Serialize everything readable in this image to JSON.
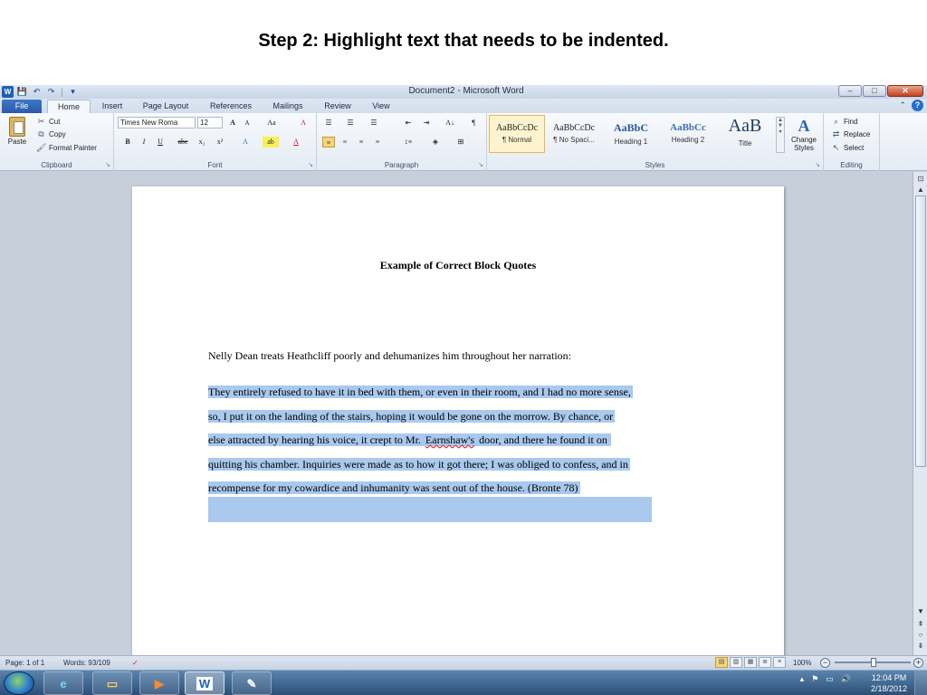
{
  "caption": "Step 2: Highlight text that needs to be indented.",
  "window": {
    "title": "Document2 - Microsoft Word",
    "controls": {
      "minimize": "–",
      "maximize": "□",
      "close": "✕"
    }
  },
  "qat": {
    "save": "💾",
    "undo": "↶",
    "redo": "↷",
    "customize": "▾"
  },
  "tabs": [
    {
      "label": "File"
    },
    {
      "label": "Home"
    },
    {
      "label": "Insert"
    },
    {
      "label": "Page Layout"
    },
    {
      "label": "References"
    },
    {
      "label": "Mailings"
    },
    {
      "label": "Review"
    },
    {
      "label": "View"
    }
  ],
  "clipboard": {
    "paste": "Paste",
    "cut": "Cut",
    "copy": "Copy",
    "format_painter": "Format Painter",
    "label": "Clipboard"
  },
  "font": {
    "family": "Times New Roma",
    "size": "12",
    "grow": "A",
    "shrink": "A",
    "change_case": "Aa",
    "clear": "A",
    "bold": "B",
    "italic": "I",
    "underline": "U",
    "strike": "abc",
    "subscript": "x₂",
    "superscript": "x²",
    "effects": "A",
    "highlight": "ab",
    "color": "A",
    "label": "Font"
  },
  "paragraph": {
    "bullets": "☰",
    "numbering": "☰",
    "multilevel": "☰",
    "decrease": "⇤",
    "increase": "⇥",
    "sort": "A↓",
    "show_marks": "¶",
    "align_left": "≡",
    "center": "≡",
    "align_right": "≡",
    "justify": "≡",
    "line_spacing": "↕≡",
    "shading": "◈",
    "borders": "⊞",
    "label": "Paragraph"
  },
  "styles": {
    "items": [
      {
        "sample": "AaBbCcDc",
        "name": "¶ Normal"
      },
      {
        "sample": "AaBbCcDc",
        "name": "¶ No Spaci..."
      },
      {
        "sample": "AaBbC",
        "name": "Heading 1"
      },
      {
        "sample": "AaBbCc",
        "name": "Heading 2"
      },
      {
        "sample": "AaB",
        "name": "Title"
      }
    ],
    "change_styles": "Change Styles",
    "label": "Styles"
  },
  "editing": {
    "find": "Find",
    "replace": "Replace",
    "select": "Select",
    "label": "Editing"
  },
  "document": {
    "title": "Example of Correct Block Quotes",
    "intro": "Nelly Dean treats Heathcliff poorly and dehumanizes him throughout her narration:",
    "quote_lines": [
      "They entirely refused to have it in bed with them, or even in their room, and I had no more sense,",
      "so, I put it on the landing of the stairs, hoping it would be gone on the morrow. By chance, or",
      "else attracted by hearing his voice, it crept to Mr.",
      "quitting his chamber. Inquiries were made as to how it got there; I was obliged to confess, and in",
      "recompense for my cowardice and inhumanity was sent out of the house. (Bronte 78)"
    ],
    "quote_line3_word": "Earnshaw's",
    "quote_line3_rest": "door, and there he found it on"
  },
  "status": {
    "page": "Page: 1 of 1",
    "words": "Words: 93/109",
    "zoom": "100%",
    "zoom_level": 1.0
  },
  "taskbar": {
    "time": "12:04 PM",
    "date": "2/18/2012",
    "apps": [
      {
        "name": "Internet Explorer",
        "glyph": "e"
      },
      {
        "name": "Windows Explorer",
        "glyph": "▭"
      },
      {
        "name": "Media Player",
        "glyph": "▶"
      },
      {
        "name": "Microsoft Word",
        "glyph": "W"
      },
      {
        "name": "Paint",
        "glyph": "✎"
      }
    ]
  },
  "colors": {
    "selection": "#a9c9ee",
    "file_tab": "#2a5aa8",
    "taskbar": "#2b4f77"
  }
}
